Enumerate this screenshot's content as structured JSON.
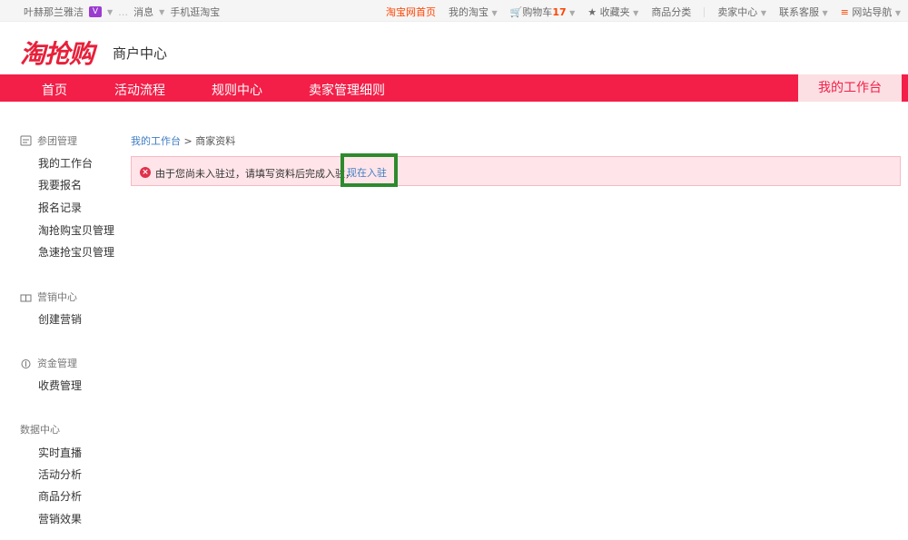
{
  "topbar": {
    "user": "叶赫那兰雅洁",
    "vip": "V",
    "messages": "消息",
    "mobile": "手机逛淘宝",
    "home": "淘宝网首页",
    "my_taobao": "我的淘宝",
    "cart": "购物车",
    "cart_count": "17",
    "favorites": "收藏夹",
    "categories": "商品分类",
    "seller": "卖家中心",
    "service": "联系客服",
    "sitenav": "网站导航"
  },
  "header": {
    "logo": "淘抢购",
    "subtitle": "商户中心"
  },
  "nav": {
    "items": [
      "首页",
      "活动流程",
      "规则中心",
      "卖家管理细则"
    ],
    "current": "我的工作台"
  },
  "sidebar": {
    "groups": [
      {
        "title": "参团管理",
        "items": [
          "我的工作台",
          "我要报名",
          "报名记录",
          "淘抢购宝贝管理",
          "急速抢宝贝管理"
        ]
      },
      {
        "title": "营销中心",
        "items": [
          "创建营销"
        ]
      },
      {
        "title": "资金管理",
        "items": [
          "收费管理"
        ]
      },
      {
        "title": "数据中心",
        "items": [
          "实时直播",
          "活动分析",
          "商品分析",
          "营销效果"
        ]
      }
    ]
  },
  "breadcrumb": {
    "link": "我的工作台",
    "sep": ">",
    "current": "商家资料"
  },
  "alert": {
    "message": "由于您尚未入驻过，请填写资料后完成入驻，",
    "action": "现在入驻"
  },
  "colors": {
    "brand": "#f31f48",
    "link": "#3f7dc4",
    "highlight": "#2d8a2d"
  }
}
